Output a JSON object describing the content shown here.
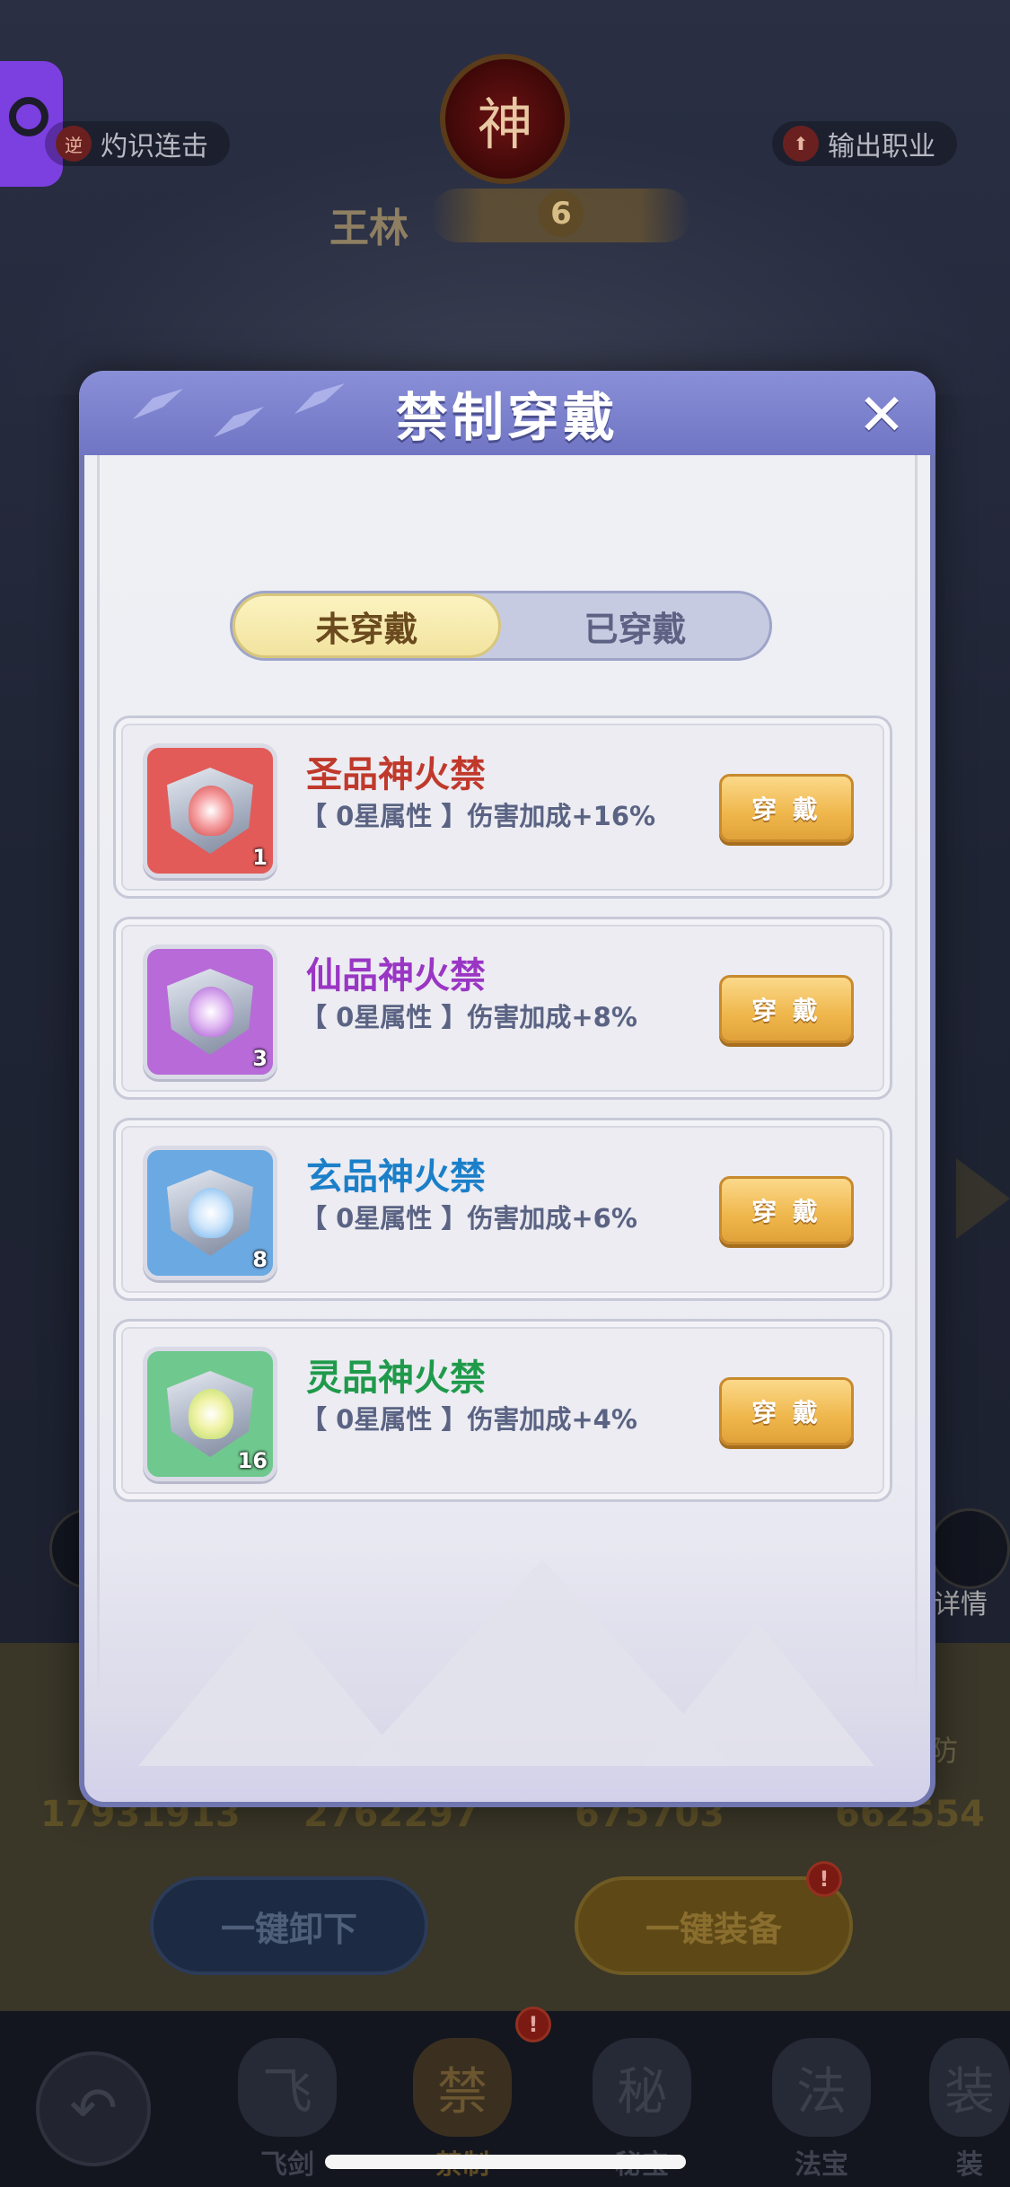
{
  "background": {
    "left_tag": "灼识连击",
    "left_tag_icon": "逆",
    "right_tag": "输出职业",
    "emblem_char": "神",
    "hero_name": "王林",
    "hero_level": "6",
    "side_right_label": "详情",
    "stats": {
      "hp_value": "17931913",
      "atk_value": "2762297",
      "v3": "675703",
      "v4": "662554",
      "def_label": "防"
    },
    "unload_all": "一键卸下",
    "equip_all": "一键装备",
    "red_dot": "!",
    "nav": [
      {
        "label": "飞剑",
        "glyph": "飞"
      },
      {
        "label": "禁制",
        "glyph": "禁"
      },
      {
        "label": "秘宝",
        "glyph": "秘"
      },
      {
        "label": "法宝",
        "glyph": "法"
      },
      {
        "label": "装",
        "glyph": "装"
      }
    ]
  },
  "modal": {
    "title": "禁制穿戴",
    "close_glyph": "✕",
    "tabs": {
      "unworn": "未穿戴",
      "worn": "已穿戴"
    },
    "items": [
      {
        "name": "圣品神火禁",
        "desc": "【 0星属性 】伤害加成+16%",
        "count": "1",
        "button": "穿 戴",
        "name_color": "#c0392b",
        "bg": "#e25b58"
      },
      {
        "name": "仙品神火禁",
        "desc": "【 0星属性 】伤害加成+8%",
        "count": "3",
        "button": "穿 戴",
        "name_color": "#9a36c4",
        "bg": "#b76ad8"
      },
      {
        "name": "玄品神火禁",
        "desc": "【 0星属性 】伤害加成+6%",
        "count": "8",
        "button": "穿 戴",
        "name_color": "#1b7fc9",
        "bg": "#6ba9e2"
      },
      {
        "name": "灵品神火禁",
        "desc": "【 0星属性 】伤害加成+4%",
        "count": "16",
        "button": "穿 戴",
        "name_color": "#1f9a4b",
        "bg": "#6fc98e"
      }
    ]
  }
}
